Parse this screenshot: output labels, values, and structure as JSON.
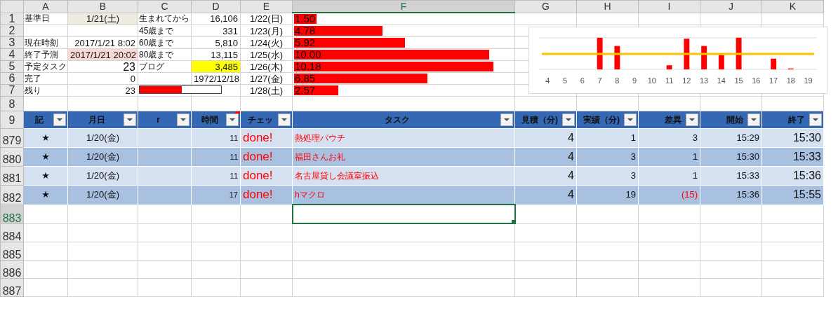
{
  "columns": [
    {
      "label": "A",
      "selected": false
    },
    {
      "label": "B",
      "selected": false
    },
    {
      "label": "C",
      "selected": false
    },
    {
      "label": "D",
      "selected": false
    },
    {
      "label": "E",
      "selected": false
    },
    {
      "label": "F",
      "selected": true
    },
    {
      "label": "G",
      "selected": false
    },
    {
      "label": "H",
      "selected": false
    },
    {
      "label": "I",
      "selected": false
    },
    {
      "label": "J",
      "selected": false
    },
    {
      "label": "K",
      "selected": false
    }
  ],
  "summary_rows": [
    {
      "row": "1",
      "a": "基準日",
      "b": "1/21(土)",
      "b_fill": {
        "color": "#eeece1"
      },
      "c": "生まれてから",
      "d": "16,106",
      "e": "1/22(日)",
      "f": "1.50",
      "level": 0.1
    },
    {
      "row": "2",
      "c": "45歳まで",
      "d": "331",
      "e": "1/23(月)",
      "f": "4.78",
      "level": 0.4
    },
    {
      "row": "3",
      "a": "現在時刻",
      "b": "2017/1/21 8:02",
      "c": "60歳まで",
      "d": "5,810",
      "e": "1/24(火)",
      "f": "5.92",
      "level": 0.5
    },
    {
      "row": "4",
      "a": "終了予測",
      "b": "2017/1/21 20:02",
      "b_fill": {
        "color": "#f8d7d4"
      },
      "c": "80歳まで",
      "d": "13,115",
      "e": "1/25(水)",
      "f": "10.00",
      "level": 0.88
    },
    {
      "row": "5",
      "a": "予定タスク",
      "b": "23",
      "c": "ブログ",
      "d": "3,485",
      "d_fill": {
        "color": "#ffff00"
      },
      "e": "1/26(木)",
      "f": "10.18",
      "level": 0.9
    },
    {
      "row": "6",
      "a": "完了",
      "b": "0",
      "d": "1972/12/18",
      "e": "1/27(金)",
      "f": "6.85",
      "level": 0.6
    },
    {
      "row": "7",
      "a": "残り",
      "b": "23",
      "e": "1/28(土)",
      "f": "2.57",
      "level": 0.2
    }
  ],
  "row_8": {
    "row": "8"
  },
  "progress": {
    "level": 0.52
  },
  "chart": {
    "x_labels": [
      "4",
      "5",
      "6",
      "7",
      "8",
      "9",
      "10",
      "11",
      "12",
      "13",
      "14",
      "15",
      "16",
      "17",
      "18",
      "19"
    ]
  },
  "header_row": {
    "row": "9",
    "headers": [
      {
        "label": "記",
        "comment": false
      },
      {
        "label": "月日",
        "comment": false
      },
      {
        "label": "r",
        "comment": false
      },
      {
        "label": "時間",
        "comment": true
      },
      {
        "label": "チェッ",
        "comment": false
      },
      {
        "label": "タスク",
        "comment": false
      },
      {
        "label": "見積（分)",
        "comment": false
      },
      {
        "label": "実績（分)",
        "comment": false
      },
      {
        "label": "差異",
        "comment": false
      },
      {
        "label": "開始",
        "comment": false
      },
      {
        "label": "終了",
        "comment": false
      }
    ]
  },
  "task_rows": [
    {
      "row": "879",
      "mark": "★",
      "date": "1/20(金)",
      "time": "11",
      "check": "done!",
      "task": "熱処理パウチ",
      "estimate": "4",
      "actual": "1",
      "diff": "3",
      "negative": false,
      "start": "15:29",
      "end": "15:30"
    },
    {
      "row": "880",
      "mark": "★",
      "date": "1/20(金)",
      "time": "11",
      "check": "done!",
      "task": "福田さんお礼",
      "estimate": "4",
      "actual": "3",
      "diff": "1",
      "negative": false,
      "start": "15:30",
      "end": "15:33"
    },
    {
      "row": "881",
      "mark": "★",
      "date": "1/20(金)",
      "time": "11",
      "check": "done!",
      "task": "名古屋貸し会議室振込",
      "estimate": "4",
      "actual": "3",
      "diff": "1",
      "negative": false,
      "start": "15:33",
      "end": "15:36"
    },
    {
      "row": "882",
      "mark": "★",
      "date": "1/20(金)",
      "time": "17",
      "check": "done!",
      "task": "hマクロ",
      "estimate": "4",
      "actual": "19",
      "diff": "(15)",
      "negative": true,
      "start": "15:36",
      "end": "15:55"
    }
  ],
  "empty_rows": [
    {
      "row": "883",
      "selected": true
    },
    {
      "row": "884",
      "selected": false
    },
    {
      "row": "885",
      "selected": false
    },
    {
      "row": "886",
      "selected": false
    },
    {
      "row": "887",
      "selected": false
    }
  ]
}
